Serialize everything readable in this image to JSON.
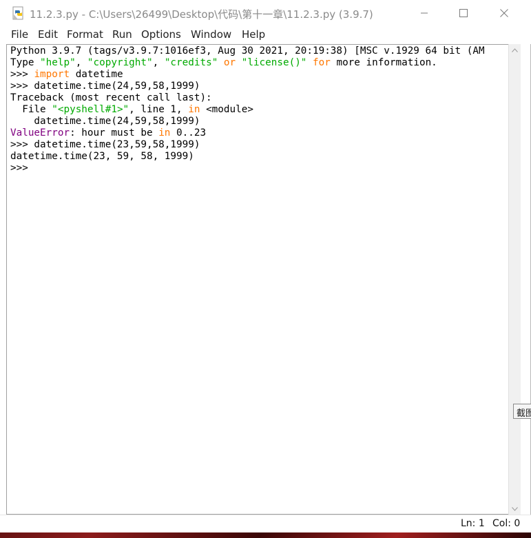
{
  "window": {
    "title": "11.2.3.py - C:\\Users\\26499\\Desktop\\代码\\第十一章\\11.2.3.py (3.9.7)",
    "icon": "python-idle-icon"
  },
  "menu": {
    "items": [
      "File",
      "Edit",
      "Format",
      "Run",
      "Options",
      "Window",
      "Help"
    ]
  },
  "shell": {
    "lines": [
      [
        {
          "t": "Python 3.9.7 (tags/v3.9.7:1016ef3, Aug 30 2021, 20:19:38) [MSC v.1929 64 bit (AM",
          "c": ""
        }
      ],
      [
        {
          "t": "Type ",
          "c": ""
        },
        {
          "t": "\"help\"",
          "c": "str"
        },
        {
          "t": ", ",
          "c": ""
        },
        {
          "t": "\"copyright\"",
          "c": "str"
        },
        {
          "t": ", ",
          "c": ""
        },
        {
          "t": "\"credits\"",
          "c": "str"
        },
        {
          "t": " ",
          "c": ""
        },
        {
          "t": "or",
          "c": "kw"
        },
        {
          "t": " ",
          "c": ""
        },
        {
          "t": "\"license()\"",
          "c": "str"
        },
        {
          "t": " ",
          "c": ""
        },
        {
          "t": "for",
          "c": "kw"
        },
        {
          "t": " more information.",
          "c": ""
        }
      ],
      [
        {
          "t": ">>> ",
          "c": ""
        },
        {
          "t": "import",
          "c": "kw"
        },
        {
          "t": " datetime",
          "c": ""
        }
      ],
      [
        {
          "t": ">>> datetime.time(24,59,58,1999)",
          "c": ""
        }
      ],
      [
        {
          "t": "Traceback (most recent call last):",
          "c": ""
        }
      ],
      [
        {
          "t": "  File ",
          "c": ""
        },
        {
          "t": "\"<pyshell#1>\"",
          "c": "str"
        },
        {
          "t": ", line 1, ",
          "c": ""
        },
        {
          "t": "in",
          "c": "kw"
        },
        {
          "t": " <module>",
          "c": ""
        }
      ],
      [
        {
          "t": "    datetime.time(24,59,58,1999)",
          "c": ""
        }
      ],
      [
        {
          "t": "ValueError",
          "c": "err"
        },
        {
          "t": ": hour must be ",
          "c": ""
        },
        {
          "t": "in",
          "c": "kw"
        },
        {
          "t": " 0..23",
          "c": ""
        }
      ],
      [
        {
          "t": ">>> datetime.time(23,59,58,1999)",
          "c": ""
        }
      ],
      [
        {
          "t": "datetime.time(23, 59, 58, 1999)",
          "c": ""
        }
      ],
      [
        {
          "t": ">>> ",
          "c": ""
        }
      ]
    ]
  },
  "status": {
    "line": "Ln: 1",
    "col": "Col: 0"
  },
  "tooltip": {
    "text": "截图"
  },
  "colors": {
    "keyword": "#ff7700",
    "string": "#00aa00",
    "error": "#800080"
  }
}
